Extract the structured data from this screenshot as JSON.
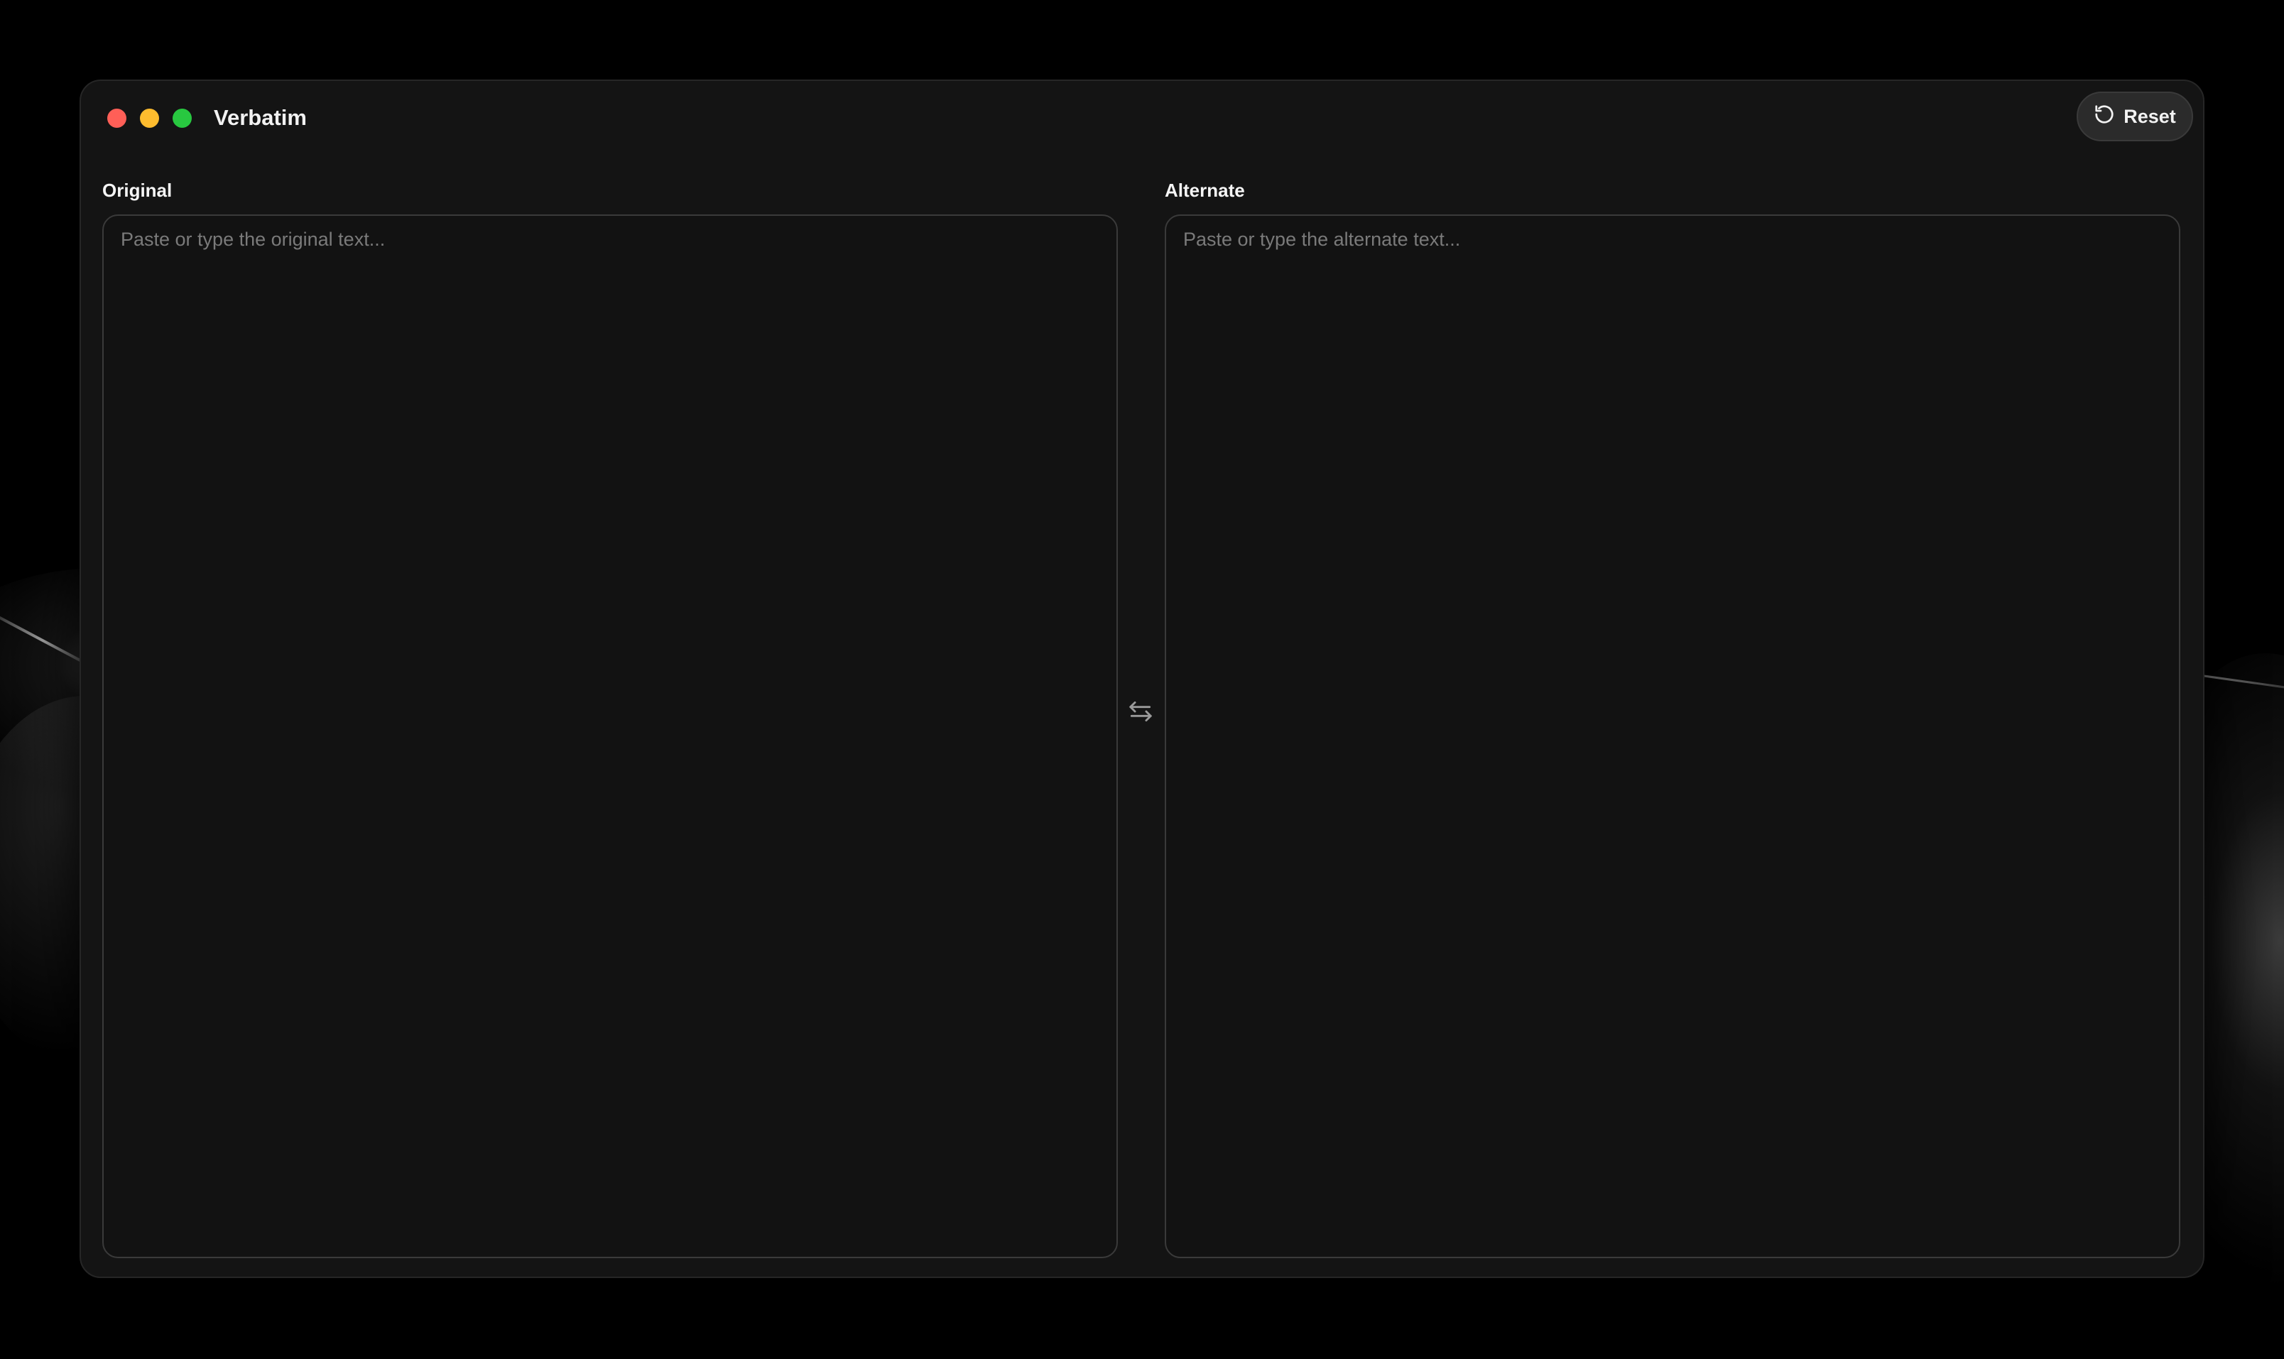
{
  "app": {
    "title": "Verbatim"
  },
  "toolbar": {
    "reset_label": "Reset",
    "reset_icon": "rotate-ccw-icon"
  },
  "panels": {
    "original": {
      "label": "Original",
      "placeholder": "Paste or type the original text...",
      "value": ""
    },
    "alternate": {
      "label": "Alternate",
      "placeholder": "Paste or type the alternate text...",
      "value": ""
    }
  },
  "swap": {
    "icon": "swap-arrows-icon"
  },
  "colors": {
    "window_bg": "#141414",
    "traffic_red": "#ff5f57",
    "traffic_yellow": "#febc2e",
    "traffic_green": "#28c840"
  }
}
